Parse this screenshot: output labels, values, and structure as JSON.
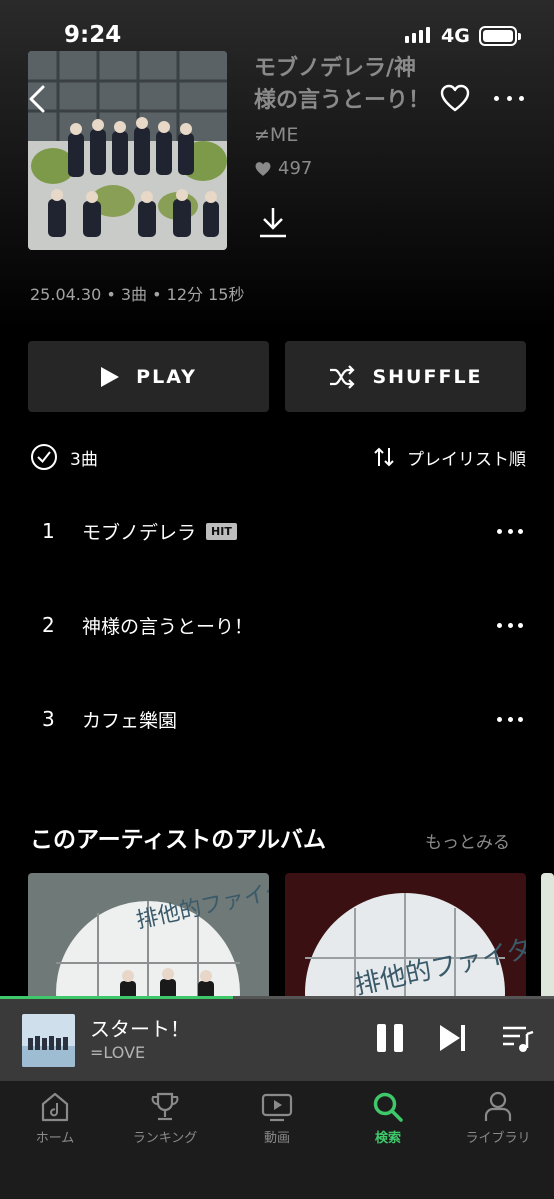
{
  "status_bar": {
    "time": "9:24",
    "network": "4G"
  },
  "album": {
    "title": "モブノデレラ/神様の言うとーり！",
    "artist": "≠ME",
    "likes": "497",
    "meta": "25.04.30 • 3曲 • 12分 15秒"
  },
  "actions": {
    "play_label": "PLAY",
    "shuffle_label": "SHUFFLE"
  },
  "track_list": {
    "count_label": "3曲",
    "sort_label": "プレイリスト順",
    "tracks": [
      {
        "number": "1",
        "title": "モブノデレラ",
        "badge": "HIT"
      },
      {
        "number": "2",
        "title": "神様の言うとーり！"
      },
      {
        "number": "3",
        "title": "カフェ樂園"
      }
    ]
  },
  "artist_albums": {
    "title": "このアーティストのアルバム",
    "see_more": "もっとみる"
  },
  "mini_player": {
    "title": "スタート！",
    "artist": "=LOVE",
    "progress": 0.42
  },
  "tab_bar": {
    "tabs": [
      {
        "label": "ホーム",
        "icon": "home-icon"
      },
      {
        "label": "ランキング",
        "icon": "trophy-icon"
      },
      {
        "label": "動画",
        "icon": "video-icon"
      },
      {
        "label": "検索",
        "icon": "search-icon",
        "active": true
      },
      {
        "label": "ライブラリ",
        "icon": "library-icon"
      }
    ]
  },
  "colors": {
    "accent": "#3fc86a",
    "button_bg": "#262626",
    "muted": "#8a8a8a"
  }
}
